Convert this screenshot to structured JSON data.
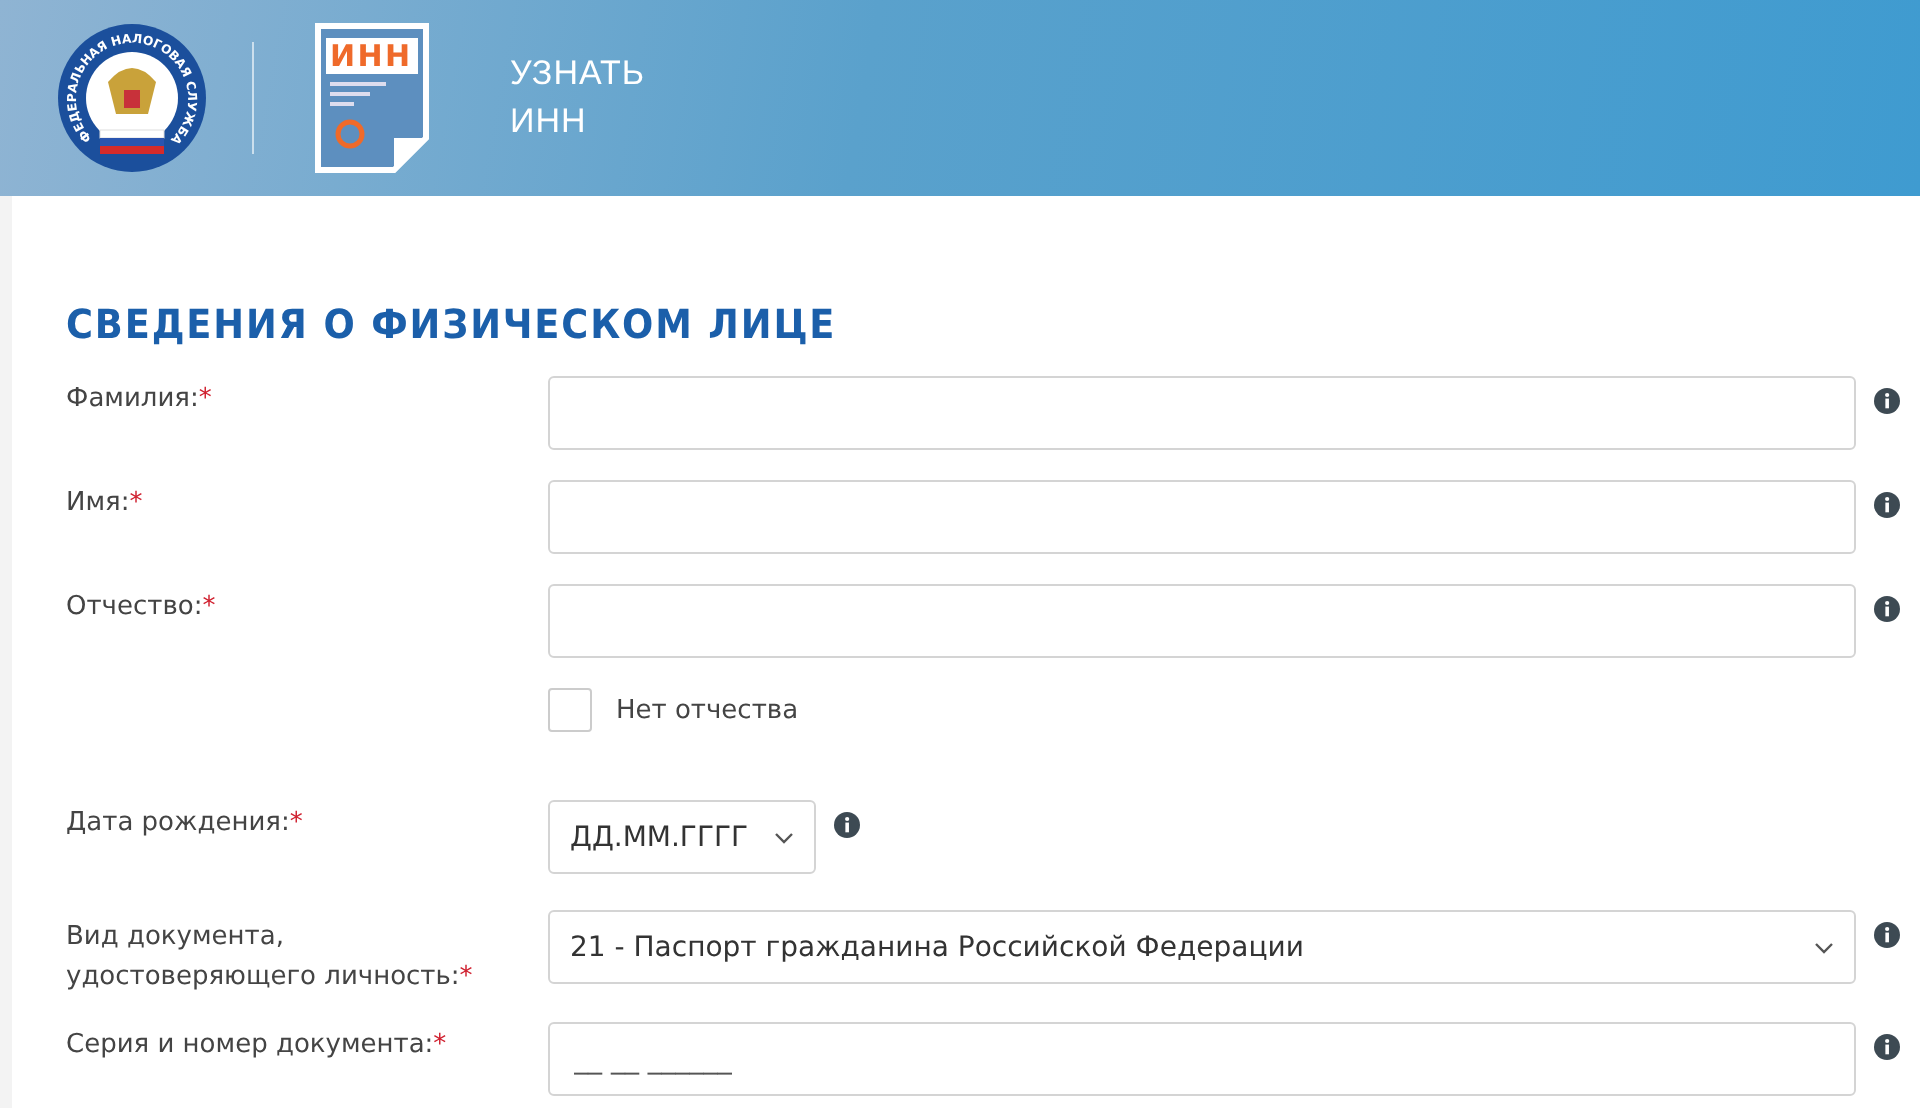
{
  "header": {
    "emblem_text": "ФЕДЕРАЛЬНАЯ НАЛОГОВАЯ СЛУЖБА",
    "doc_icon_text": "ИНН",
    "title_lines": [
      "УЗНАТЬ",
      "ИНН"
    ]
  },
  "section": {
    "title": "СВЕДЕНИЯ О ФИЗИЧЕСКОМ ЛИЦЕ"
  },
  "fields": [
    {
      "kind": "text",
      "label": "Фамилия:",
      "required_mark": "*"
    },
    {
      "kind": "text",
      "label": "Имя:",
      "required_mark": "*"
    },
    {
      "kind": "text",
      "label": "Отчество:",
      "required_mark": "*"
    },
    {
      "kind": "checkbox",
      "text": "Нет отчества",
      "checked": false
    },
    {
      "kind": "date",
      "label": "Дата рождения:",
      "required_mark": "*",
      "value": "ДД.ММ.ГГГГ"
    },
    {
      "kind": "select",
      "label_lines": [
        "Вид документа,",
        "удостоверяющего личность:"
      ],
      "required_mark": "*",
      "value": "21 - Паспорт гражданина Российской Федерации"
    },
    {
      "kind": "text",
      "label": "Серия и номер документа:",
      "required_mark": "*",
      "placeholder": "__ __ ______"
    }
  ]
}
